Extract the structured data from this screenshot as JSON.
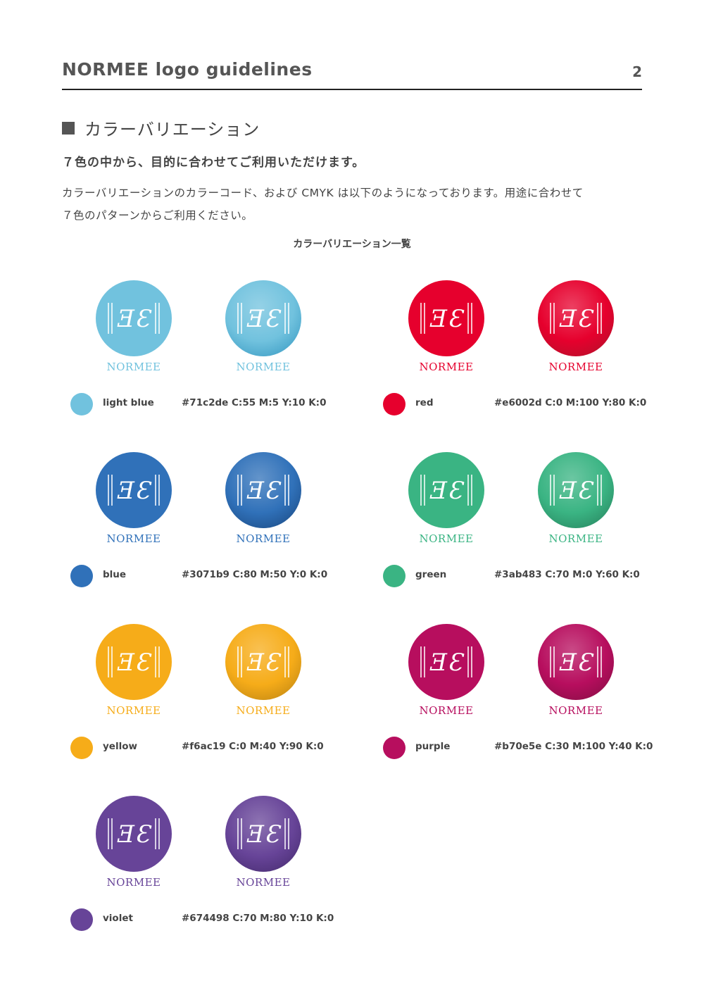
{
  "header": {
    "title": "NORMEE logo guidelines",
    "page_number": "2"
  },
  "section": {
    "title": "カラーバリエーション"
  },
  "subtitle": "７色の中から、目的に合わせてご利用いただけます。",
  "body": {
    "line1": "カラーバリエーションのカラーコード、および CMYK は以下のようになっております。用途に合わせて",
    "line2": "７色のパターンからご利用ください。"
  },
  "list_caption": "カラーバリエーション一覧",
  "logo": {
    "monogram": "ƎƐ",
    "wordmark": "NORMEE"
  },
  "colors": [
    {
      "name": "light blue",
      "spec": "#71c2de  C:55 M:5 Y:10 K:0",
      "hex": "#71c2de",
      "dark": "#3f9fc6"
    },
    {
      "name": "red",
      "spec": "#e6002d C:0 M:100 Y:80 K:0",
      "hex": "#e6002d",
      "dark": "#b8102c"
    },
    {
      "name": "blue",
      "spec": "#3071b9  C:80 M:50 Y:0 K:0",
      "hex": "#3071b9",
      "dark": "#1e4f8a"
    },
    {
      "name": "green",
      "spec": "#3ab483  C:70 M:0 Y:60 K:0",
      "hex": "#3ab483",
      "dark": "#2a8a63"
    },
    {
      "name": "yellow",
      "spec": "#f6ac19   C:0 M:40 Y:90 K:0",
      "hex": "#f6ac19",
      "dark": "#c58a14"
    },
    {
      "name": "purple",
      "spec": "#b70e5e  C:30 M:100 Y:40 K:0",
      "hex": "#b70e5e",
      "dark": "#8c0f48"
    },
    {
      "name": "violet",
      "spec": "#674498  C:70 M:80 Y:10 K:0",
      "hex": "#674498",
      "dark": "#4b2f75"
    }
  ]
}
